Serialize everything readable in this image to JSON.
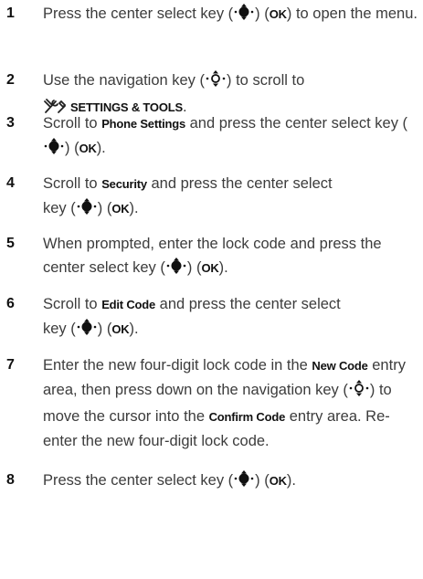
{
  "steps": [
    {
      "num": "1",
      "parts": [
        {
          "t": "text",
          "v": "Press the center select key ("
        },
        {
          "t": "icon",
          "v": "center-select-key-icon"
        },
        {
          "t": "text",
          "v": ") ("
        },
        {
          "t": "ui",
          "v": "OK"
        },
        {
          "t": "text",
          "v": ") to open the menu."
        }
      ]
    },
    {
      "num": "2",
      "parts": [
        {
          "t": "text",
          "v": "Use the navigation key ("
        },
        {
          "t": "icon",
          "v": "navigation-key-icon"
        },
        {
          "t": "text",
          "v": ") to scroll to "
        },
        {
          "t": "br"
        },
        {
          "t": "icon",
          "v": "settings-tools-icon"
        },
        {
          "t": "ui",
          "v": "SETTINGS & TOOLS"
        },
        {
          "t": "text",
          "v": "."
        }
      ]
    },
    {
      "num": "3",
      "parts": [
        {
          "t": "text",
          "v": "Scroll to "
        },
        {
          "t": "ui",
          "v": "Phone Settings"
        },
        {
          "t": "text",
          "v": " and press the center select key ("
        },
        {
          "t": "icon",
          "v": "center-select-key-icon"
        },
        {
          "t": "text",
          "v": ") ("
        },
        {
          "t": "ui",
          "v": "OK"
        },
        {
          "t": "text",
          "v": ")."
        }
      ]
    },
    {
      "num": "4",
      "parts": [
        {
          "t": "text",
          "v": "Scroll to "
        },
        {
          "t": "ui",
          "v": "Security"
        },
        {
          "t": "text",
          "v": " and press the center select "
        },
        {
          "t": "br"
        },
        {
          "t": "text",
          "v": "key ("
        },
        {
          "t": "icon",
          "v": "center-select-key-icon"
        },
        {
          "t": "text",
          "v": ") ("
        },
        {
          "t": "ui",
          "v": "OK"
        },
        {
          "t": "text",
          "v": ")."
        }
      ]
    },
    {
      "num": "5",
      "parts": [
        {
          "t": "text",
          "v": "When prompted, enter the lock code and press the center select key ("
        },
        {
          "t": "icon",
          "v": "center-select-key-icon"
        },
        {
          "t": "text",
          "v": ") ("
        },
        {
          "t": "ui",
          "v": "OK"
        },
        {
          "t": "text",
          "v": ")."
        }
      ]
    },
    {
      "num": "6",
      "parts": [
        {
          "t": "text",
          "v": "Scroll to "
        },
        {
          "t": "ui",
          "v": "Edit Code"
        },
        {
          "t": "text",
          "v": " and press the center select "
        },
        {
          "t": "br"
        },
        {
          "t": "text",
          "v": "key ("
        },
        {
          "t": "icon",
          "v": "center-select-key-icon"
        },
        {
          "t": "text",
          "v": ") ("
        },
        {
          "t": "ui",
          "v": "OK"
        },
        {
          "t": "text",
          "v": ")."
        }
      ]
    },
    {
      "num": "7",
      "parts": [
        {
          "t": "text",
          "v": "Enter the new four-digit lock code in the "
        },
        {
          "t": "ui",
          "v": "New Code"
        },
        {
          "t": "text",
          "v": " entry area, then press down on the navigation key ("
        },
        {
          "t": "icon",
          "v": "navigation-key-icon"
        },
        {
          "t": "text",
          "v": ") to move the cursor into the "
        },
        {
          "t": "ui",
          "v": "Confirm Code"
        },
        {
          "t": "text",
          "v": " entry area. Re-enter the new four-digit lock code."
        }
      ]
    },
    {
      "num": "8",
      "parts": [
        {
          "t": "text",
          "v": "Press the center select key ("
        },
        {
          "t": "icon",
          "v": "center-select-key-icon"
        },
        {
          "t": "text",
          "v": ") ("
        },
        {
          "t": "ui",
          "v": "OK"
        },
        {
          "t": "text",
          "v": ")."
        }
      ]
    }
  ]
}
